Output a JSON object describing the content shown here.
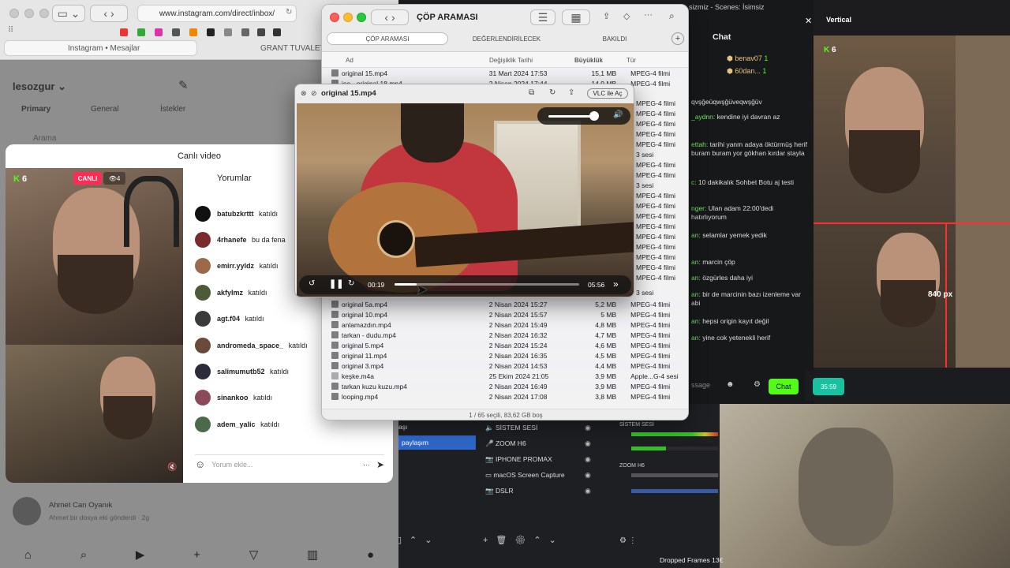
{
  "safari": {
    "address": "www.instagram.com/direct/inbox/",
    "tabs": [
      "Instagram • Mesajlar",
      "GRANT TUVALET"
    ]
  },
  "instagram": {
    "username": "lesozgur",
    "tabs": [
      "Primary",
      "General",
      "İstekler"
    ],
    "search_placeholder": "Arama",
    "live_title": "Canlı video",
    "live_badge": "CANLI",
    "viewers": "4",
    "k_count": "6",
    "comments_heading": "Yorumlar",
    "comments": [
      {
        "user": "batubzkrttt",
        "text": "katıldı",
        "color": "#111"
      },
      {
        "user": "4rhanefe",
        "text": "bu da fena",
        "color": "#7a2b2b"
      },
      {
        "user": "emirr.yyldz",
        "text": "katıldı",
        "color": "#9a6a4a"
      },
      {
        "user": "akfylmz",
        "text": "katıldı",
        "color": "#4c5a3a"
      },
      {
        "user": "agt.f04",
        "text": "katıldı",
        "color": "#3b3b3b"
      },
      {
        "user": "andromeda_space_",
        "text": "katıldı",
        "color": "#6a4a3a"
      },
      {
        "user": "salimumutb52",
        "text": "katıldı",
        "color": "#2b2b3b"
      },
      {
        "user": "sinankoo",
        "text": "katıldı",
        "color": "#8a4a5a"
      },
      {
        "user": "adem_yalic",
        "text": "katıldı",
        "color": "#4a6a4a"
      }
    ],
    "comment_placeholder": "Yorum ekle...",
    "list_name": "Ahmet Can Oyanık",
    "list_preview": "Ahmet bir dosya eki gönderdi · 2g"
  },
  "finder": {
    "title": "ÇÖP ARAMASI",
    "segments": [
      "ÇÖP ARAMASI",
      "DEĞERLENDİRİLECEK",
      "BAKILDI"
    ],
    "columns": {
      "name": "Ad",
      "date": "Değişiklik Tarihi",
      "size": "Büyüklük",
      "kind": "Tür"
    },
    "rows_top": [
      {
        "name": "original 15.mp4",
        "date": "31 Mart 2024 17:53",
        "size": "15,1 MB",
        "kind": "MPEG-4 filmi"
      },
      {
        "name": "joe - original 18.mp4",
        "date": "2 Nisan 2024 17:44",
        "size": "14,9 MB",
        "kind": "MPEG-4 filmi"
      }
    ],
    "side_kinds": [
      "MPEG-4 filmi",
      "MPEG-4 filmi",
      "MPEG-4 filmi",
      "MPEG-4 filmi",
      "MPEG-4 filmi",
      "3 sesi",
      "MPEG-4 filmi",
      "MPEG-4 filmi",
      "3 sesi",
      "MPEG-4 filmi",
      "MPEG-4 filmi",
      "MPEG-4 filmi",
      "MPEG-4 filmi",
      "MPEG-4 filmi",
      "MPEG-4 filmi",
      "MPEG-4 filmi",
      "MPEG-4 filmi",
      "MPEG-4 filmi",
      "3 sesi"
    ],
    "rows_bottom": [
      {
        "name": "original 5a.mp4",
        "date": "2 Nisan 2024 15:27",
        "size": "5,2 MB",
        "kind": "MPEG-4 filmi"
      },
      {
        "name": "original 10.mp4",
        "date": "2 Nisan 2024 15:57",
        "size": "5 MB",
        "kind": "MPEG-4 filmi"
      },
      {
        "name": "anlamazdın.mp4",
        "date": "2 Nisan 2024 15:49",
        "size": "4,8 MB",
        "kind": "MPEG-4 filmi"
      },
      {
        "name": "tarkan - dudu.mp4",
        "date": "2 Nisan 2024 16:32",
        "size": "4,7 MB",
        "kind": "MPEG-4 filmi"
      },
      {
        "name": "original 5.mp4",
        "date": "2 Nisan 2024 15:24",
        "size": "4,6 MB",
        "kind": "MPEG-4 filmi"
      },
      {
        "name": "original 11.mp4",
        "date": "2 Nisan 2024 16:35",
        "size": "4,5 MB",
        "kind": "MPEG-4 filmi"
      },
      {
        "name": "original 3.mp4",
        "date": "2 Nisan 2024 14:53",
        "size": "4,4 MB",
        "kind": "MPEG-4 filmi"
      },
      {
        "name": "keşke.m4a",
        "date": "25 Ekim 2024 21:05",
        "size": "3,9 MB",
        "kind": "Apple...G-4 sesi"
      },
      {
        "name": "tarkan kuzu kuzu.mp4",
        "date": "2 Nisan 2024 16:49",
        "size": "3,9 MB",
        "kind": "MPEG-4 filmi"
      },
      {
        "name": "looping.mp4",
        "date": "2 Nisan 2024 17:08",
        "size": "3,8 MB",
        "kind": "MPEG-4 filmi"
      }
    ],
    "status": "1 / 65 seçili, 83,62 GB boş"
  },
  "player": {
    "title": "original 15.mp4",
    "open_with": "VLC ile Aç",
    "elapsed": "00:19",
    "duration": "05:56",
    "progress": 0.12,
    "volume": 0.85
  },
  "obs": {
    "window_title": "sizmiz - Scenes: İsimsiz",
    "chat_title": "Chat",
    "vertical_title": "Vertical",
    "k_count": "6",
    "crop_label": "840 px",
    "chat_top_users": [
      {
        "user": "benav07",
        "count": "1"
      },
      {
        "user": "60dan...",
        "count": "1"
      }
    ],
    "chat_lines": [
      {
        "u": "",
        "t": "qvşğeüqwşğüveqwşğüv"
      },
      {
        "u": "_aydnn:",
        "t": "kendine iyi davran az"
      },
      {
        "u": "ettah:",
        "t": "tarihi yanm adaya öktürmüş herif buram buram yor gökhan kırdar stayla"
      },
      {
        "u": "c:",
        "t": "10 dakikalık Sohbet Botu aj testi"
      },
      {
        "u": "nger:",
        "t": "Ulan adam 22:00'dedi hatırlıyorum"
      },
      {
        "u": "an:",
        "t": "selamlar yemek yedik"
      },
      {
        "u": "an:",
        "t": "marcin çöp"
      },
      {
        "u": "an:",
        "t": "özgürles daha iyi"
      },
      {
        "u": "an:",
        "t": "bir de marcinin bazı izenleme var abi"
      },
      {
        "u": "an:",
        "t": "hepsi origin kayıt değil"
      },
      {
        "u": "an:",
        "t": "yine cok yetenekli herif"
      }
    ],
    "chat_placeholder": "ssage",
    "chat_button": "Chat",
    "timer": "35:59",
    "scene_selected": "paylaşım",
    "scene_top": "aşı",
    "sources": [
      "SİSTEM SESİ",
      "ZOOM H6",
      "IPHONE PROMAX",
      "macOS Screen Capture",
      "DSLR"
    ],
    "mixer": [
      "SİSTEM SESİ",
      "ZOOM H6"
    ],
    "dropped": "Dropped Frames 13€"
  }
}
